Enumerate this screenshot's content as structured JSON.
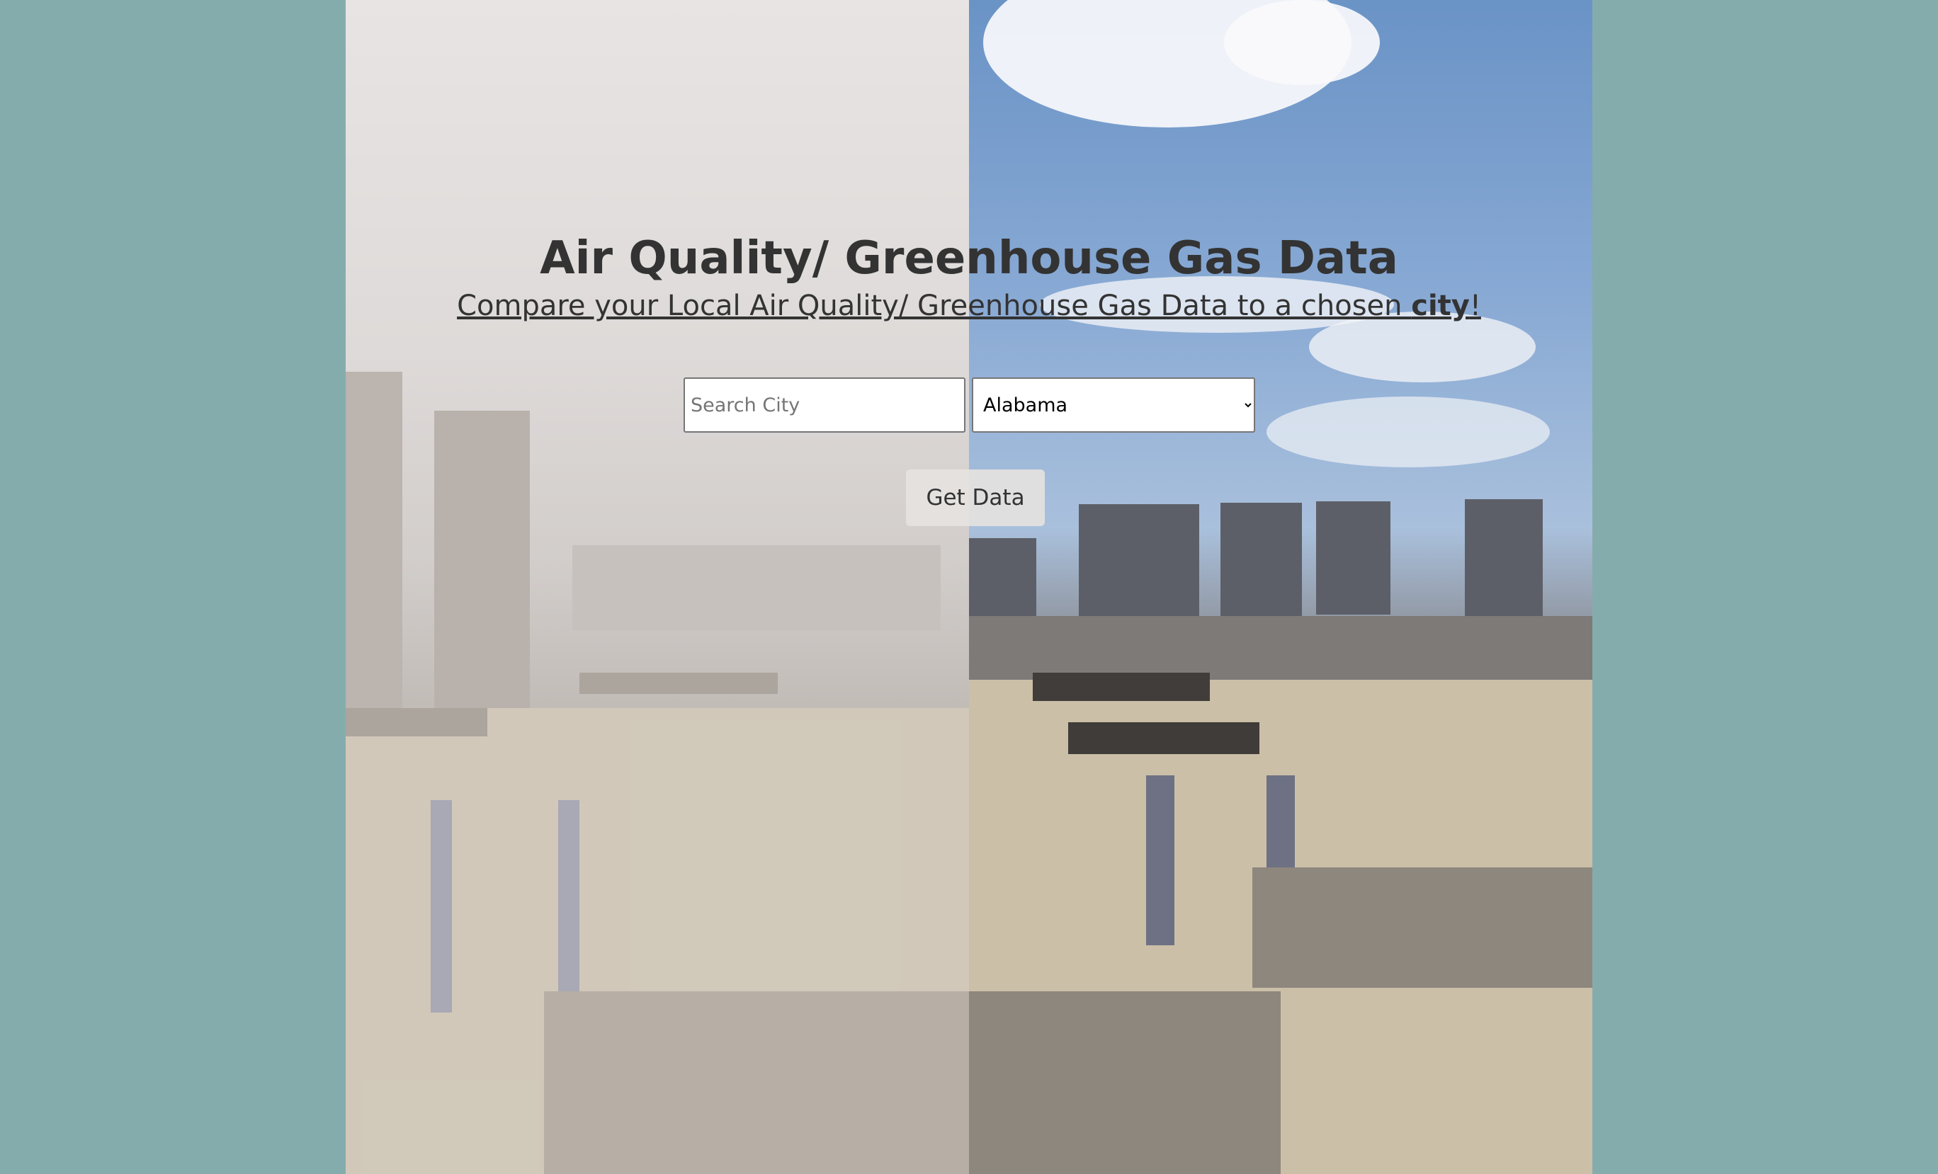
{
  "page": {
    "background_color": "#85acac",
    "title": "Air Quality/ Greenhouse Gas Data",
    "subtitle_text": "Compare your Local Air Quality/ Greenhouse Gas Data to a chosen ",
    "subtitle_emphasis": "city",
    "subtitle_end": "!"
  },
  "form": {
    "search_placeholder": "Search City",
    "state_selected": "Alabama",
    "state_options": [
      "Alabama"
    ],
    "submit_label": "Get Data"
  },
  "hero_image": {
    "description_icon": "smog-vs-clear-sky-city-photo"
  }
}
